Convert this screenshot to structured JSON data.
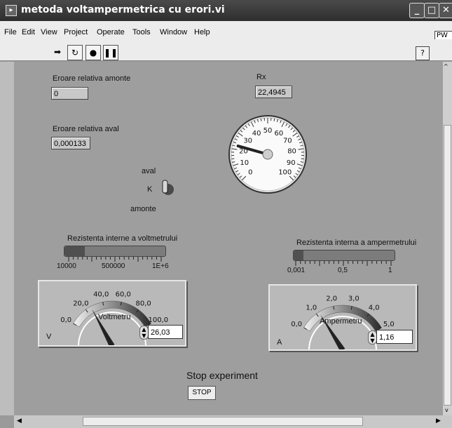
{
  "window": {
    "title": "metoda voltampermetrica cu erori.vi",
    "icon": "vi-icon"
  },
  "menu": [
    "File",
    "Edit",
    "View",
    "Project",
    "Operate",
    "Tools",
    "Window",
    "Help"
  ],
  "toolbar": {
    "pw_label": "PW",
    "help_label": "?"
  },
  "controls": {
    "eroare_amonte": {
      "label": "Eroare relativa amonte",
      "value": "0"
    },
    "eroare_aval": {
      "label": "Eroare relativa aval",
      "value": "0,000133"
    },
    "rx": {
      "label": "Rx",
      "value": "22,4945"
    },
    "switch": {
      "top_label": "aval",
      "name_label": "K",
      "bottom_label": "amonte"
    },
    "rx_gauge": {
      "ticks": [
        "0",
        "10",
        "20",
        "30",
        "40",
        "50",
        "60",
        "70",
        "80",
        "90",
        "100"
      ],
      "value": 22.4945
    },
    "volt_res": {
      "label": "Rezistenta interne a voltmetrului",
      "ticks": [
        "10000",
        "500000",
        "1E+6"
      ],
      "fill": 0.2
    },
    "amp_res": {
      "label": "Rezistenta interna a ampermetrului",
      "ticks": [
        "0,001",
        "0,5",
        "1"
      ],
      "fill": 0.1
    },
    "voltmetru": {
      "name": "Voltmetru",
      "unit": "V",
      "ticks": [
        "0,0",
        "20,0",
        "40,0",
        "60,0",
        "80,0",
        "100,0"
      ],
      "value": "26,03",
      "numeric": 26.03,
      "max": 100
    },
    "ampermetru": {
      "name": "Ampermetru",
      "unit": "A",
      "ticks": [
        "0,0",
        "1,0",
        "2,0",
        "3,0",
        "4,0",
        "5,0"
      ],
      "value": "1,16",
      "numeric": 1.16,
      "max": 5
    },
    "stop": {
      "title": "Stop experiment",
      "button": "STOP"
    }
  }
}
